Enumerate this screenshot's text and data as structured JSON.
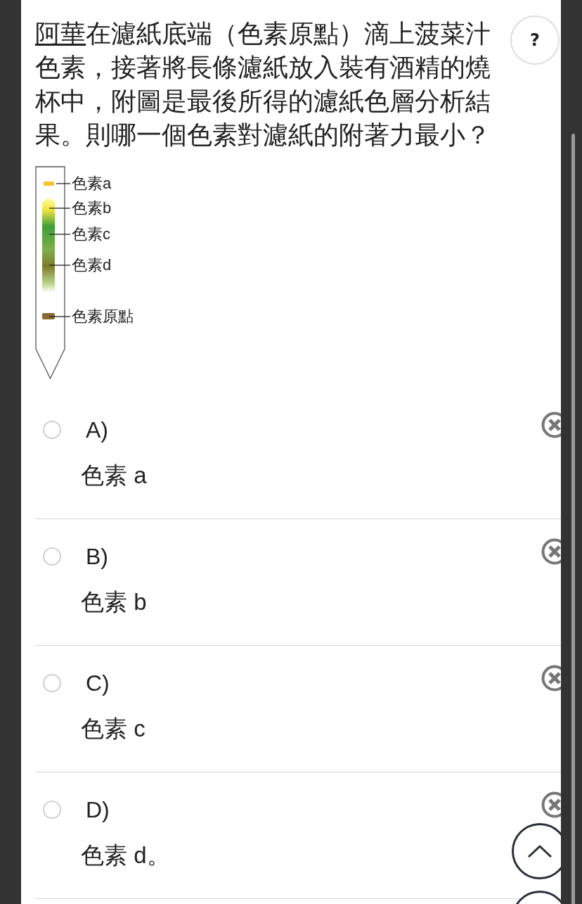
{
  "question": {
    "underlined": "阿華",
    "text": "在濾紙底端（色素原點）滴上菠菜汁色素，接著將長條濾紙放入裝有酒精的燒杯中，附圖是最後所得的濾紙色層分析結果。則哪一個色素對濾紙的附著力最小？"
  },
  "help_button": {
    "label": "?"
  },
  "figure": {
    "labels": [
      "色素a",
      "色素b",
      "色素c",
      "色素d",
      "色素原點"
    ]
  },
  "options": [
    {
      "letter": "A)",
      "text": "色素 a",
      "selected": false
    },
    {
      "letter": "B)",
      "text": "色素 b",
      "selected": false
    },
    {
      "letter": "C)",
      "text": "色素 c",
      "selected": false
    },
    {
      "letter": "D)",
      "text": "色素 d。",
      "selected": false
    }
  ]
}
